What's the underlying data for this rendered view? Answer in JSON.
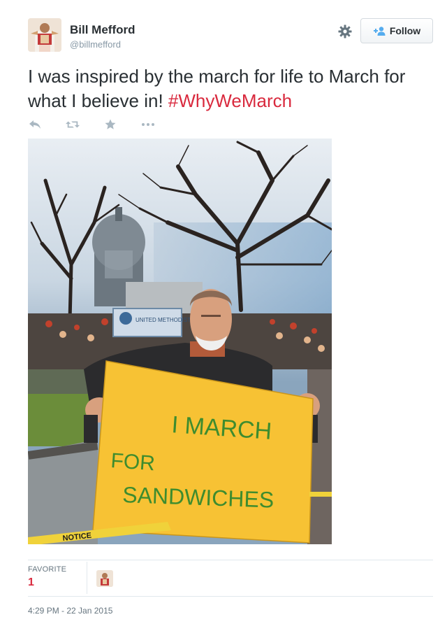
{
  "user": {
    "name": "Bill Mefford",
    "handle": "@billmefford"
  },
  "header": {
    "follow_label": "Follow"
  },
  "tweet": {
    "text_before": "I was inspired by the march for life to March for what I believe in! ",
    "hashtag": "#WhyWeMarch"
  },
  "actions": {
    "icons": [
      "reply-icon",
      "retweet-icon",
      "favorite-icon",
      "more-icon"
    ]
  },
  "photo": {
    "banner_text": "UNITED METHODISTS",
    "sign_lines": [
      "I MARCH",
      "FOR",
      "SANDWICHES"
    ],
    "tape_text": "NOTICE"
  },
  "stats": {
    "favorites_label": "FAVORITE",
    "favorites_count": "1"
  },
  "meta": {
    "timestamp": "4:29 PM - 22 Jan 2015"
  },
  "colors": {
    "hashtag": "#d92a3e",
    "sign": "#f7c234",
    "sign_ink": "#3e8c2e"
  }
}
